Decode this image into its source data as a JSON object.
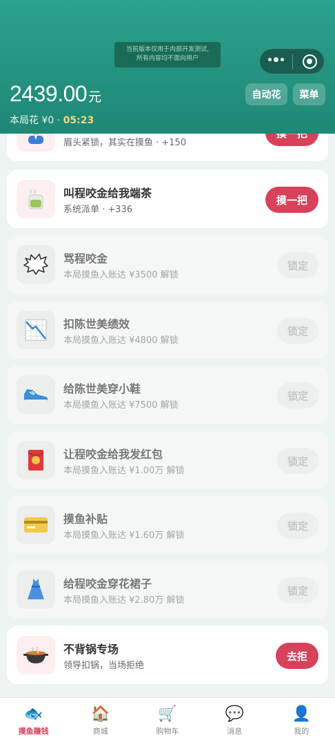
{
  "header": {
    "notice_line1": "当前版本仅用于内部开发测试,",
    "notice_line2": "所有内容均不面向用户",
    "amount": "2439.00",
    "amount_unit": "元",
    "round_spent": "本局花 ¥0 · ",
    "round_time": "05:23",
    "auto_button": "自动花",
    "menu_button": "菜单"
  },
  "tasks": [
    {
      "title": "",
      "sub": "眉头紧锁，其实在摸鱼 · +150",
      "button": "摸一把",
      "locked": false,
      "icon": "office-worker-icon"
    },
    {
      "title": "叫程咬金给我端茶",
      "sub": "系统派单 · +336",
      "button": "摸一把",
      "locked": false,
      "icon": "tea-cup-icon"
    },
    {
      "title": "骂程咬金",
      "sub": "本局摸鱼入账达 ¥3500 解锁",
      "button": "锁定",
      "locked": true,
      "icon": "anger-bubble-icon"
    },
    {
      "title": "扣陈世美绩效",
      "sub": "本局摸鱼入账达 ¥4800 解锁",
      "button": "锁定",
      "locked": true,
      "icon": "chart-down-icon"
    },
    {
      "title": "给陈世美穿小鞋",
      "sub": "本局摸鱼入账达 ¥7500 解锁",
      "button": "锁定",
      "locked": true,
      "icon": "shoe-icon"
    },
    {
      "title": "让程咬金给我发红包",
      "sub": "本局摸鱼入账达 ¥1.00万 解锁",
      "button": "锁定",
      "locked": true,
      "icon": "red-envelope-icon"
    },
    {
      "title": "摸鱼补贴",
      "sub": "本局摸鱼入账达 ¥1.60万 解锁",
      "button": "锁定",
      "locked": true,
      "icon": "credit-card-icon"
    },
    {
      "title": "给程咬金穿花裙子",
      "sub": "本局摸鱼入账达 ¥2.80万 解锁",
      "button": "锁定",
      "locked": true,
      "icon": "dress-icon"
    },
    {
      "title": "不背锅专场",
      "sub": "领导扣锅，当场拒绝",
      "button": "去拒",
      "locked": false,
      "icon": "pot-icon"
    }
  ],
  "nav": [
    {
      "label": "摸鱼赚钱",
      "icon": "fish-icon",
      "glyph": "🐟",
      "active": true
    },
    {
      "label": "商城",
      "icon": "house-icon",
      "glyph": "🏠",
      "active": false
    },
    {
      "label": "购物车",
      "icon": "cart-icon",
      "glyph": "🛒",
      "active": false
    },
    {
      "label": "消息",
      "icon": "speech-bubble-icon",
      "glyph": "💬",
      "active": false
    },
    {
      "label": "我的",
      "icon": "user-icon",
      "glyph": "👤",
      "active": false
    }
  ],
  "colors": {
    "accent": "#d8415a",
    "header": "#1f8775",
    "time": "#f5d77a"
  }
}
